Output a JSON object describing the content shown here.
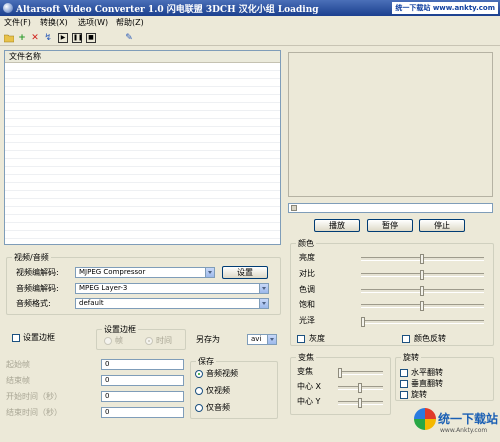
{
  "window": {
    "title": "Altarsoft Video Converter 1.0 闪电联盟 3DCH 汉化小组 Loading",
    "watermark": "统一下载站 www.ankty.com"
  },
  "menu": [
    "文件(F)",
    "转换(X)",
    "选项(W)",
    "帮助(Z)"
  ],
  "toolbar_icons": [
    "open-folder-icon",
    "add-icon",
    "remove-icon",
    "settings-icon",
    "play-icon",
    "pause-icon",
    "stop-icon",
    "tool-icon"
  ],
  "file_list": {
    "header": "文件名称",
    "rows": []
  },
  "player": {
    "play": "播放",
    "pause": "暂停",
    "stop": "停止"
  },
  "video_audio": {
    "title": "视频/音频",
    "video_codec_label": "视频编解码:",
    "video_codec": "MJPEG Compressor",
    "settings_button": "设置",
    "audio_codec_label": "音频编解码:",
    "audio_codec": "MPEG Layer-3",
    "audio_format_label": "音频格式:",
    "audio_format": "default"
  },
  "border": {
    "checkbox": "设置边框",
    "group_title": "设置边框",
    "frame": "帧",
    "time": "时间"
  },
  "save_as": {
    "label": "另存为",
    "value": "avi"
  },
  "timing": [
    {
      "label": "起始帧",
      "value": "0"
    },
    {
      "label": "结束帧",
      "value": "0"
    },
    {
      "label": "开始时间（秒）",
      "value": "0"
    },
    {
      "label": "结束时间（秒）",
      "value": "0"
    }
  ],
  "save_group": {
    "title": "保存",
    "options": [
      "音频视频",
      "仅视频",
      "仅音频"
    ],
    "selected": 0
  },
  "color": {
    "title": "颜色",
    "sliders": [
      {
        "label": "亮度",
        "value": 0.5
      },
      {
        "label": "对比",
        "value": 0.5
      },
      {
        "label": "色调",
        "value": 0.5
      },
      {
        "label": "饱和",
        "value": 0.5
      },
      {
        "label": "光泽",
        "value": 0.0
      }
    ],
    "grayscale": "灰度",
    "invert": "颜色反转"
  },
  "transform": {
    "title": "变焦",
    "sliders": [
      {
        "label": "变焦",
        "value": 0.0
      },
      {
        "label": "中心 X",
        "value": 0.5
      },
      {
        "label": "中心 Y",
        "value": 0.5
      }
    ]
  },
  "rotate": {
    "title": "旋转",
    "options": [
      "水平翻转",
      "垂直翻转",
      "旋转"
    ]
  },
  "logo": {
    "name": "统一下载站",
    "url": "www.Ankty.com"
  }
}
